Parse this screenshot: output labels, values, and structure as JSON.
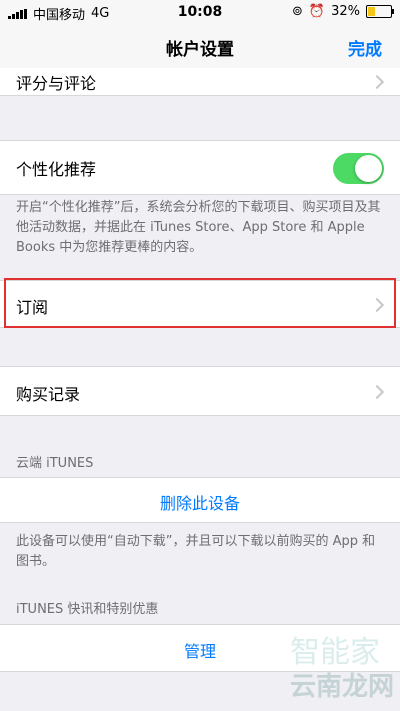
{
  "status": {
    "carrier": "中国移动",
    "network": "4G",
    "time": "10:08",
    "battery": "32%",
    "battery_level": 0.32
  },
  "nav": {
    "title": "帐户设置",
    "done": "完成"
  },
  "rows": {
    "ratings": "评分与评论",
    "personalized": "个性化推荐",
    "subscriptions": "订阅",
    "purchase_history": "购买记录"
  },
  "personalized_note": "开启“个性化推荐”后，系统会分析您的下载项目、购买项目及其他活动数据，并据此在 iTunes Store、App Store 和 Apple Books 中为您推荐更棒的内容。",
  "icloud": {
    "header": "云端 iTUNES",
    "action": "删除此设备",
    "note": "此设备可以使用“自动下载”，并且可以下载以前购买的 App 和图书。"
  },
  "newsletter": {
    "header": "iTUNES 快讯和特别优惠",
    "action": "管理"
  },
  "watermark": {
    "top": "智能家",
    "bottom": "云南龙网"
  },
  "colors": {
    "accent": "#007aff",
    "toggle_on": "#4cd964",
    "highlight": "#e03030"
  }
}
